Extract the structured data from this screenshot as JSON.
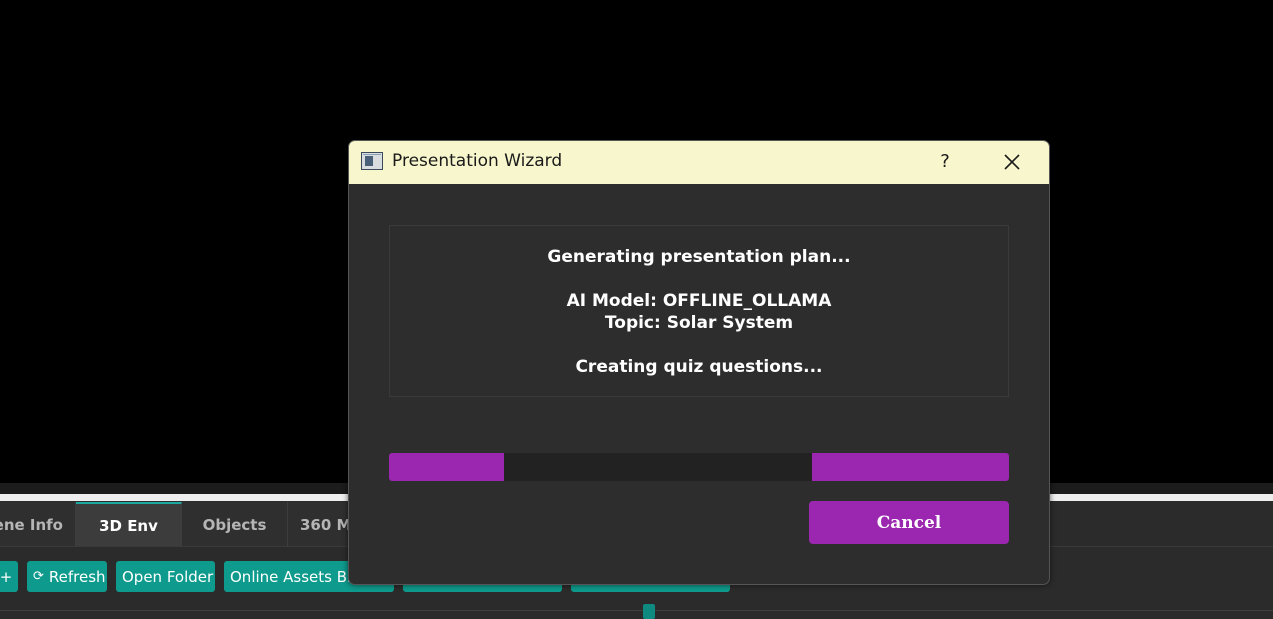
{
  "app": {
    "tabs": [
      {
        "label": "Scene Info",
        "active": false
      },
      {
        "label": "3D Env",
        "active": true
      },
      {
        "label": "Objects",
        "active": false
      },
      {
        "label": "360 M",
        "active": false
      }
    ],
    "toolbar": [
      {
        "label": "+",
        "icon": ""
      },
      {
        "label": "Refresh",
        "icon": "refresh-icon"
      },
      {
        "label": "Open Folder",
        "icon": ""
      },
      {
        "label": "Online Assets Br",
        "icon": ""
      },
      {
        "label": "",
        "icon": ""
      },
      {
        "label": "",
        "icon": ""
      }
    ],
    "colors": {
      "accent_teal": "#0e9a8c",
      "accent_purple": "#9b27b0",
      "titlebar": "#f8f6cc"
    }
  },
  "dialog": {
    "title": "Presentation Wizard",
    "help_label": "?",
    "status_heading": "Generating presentation plan...",
    "model_line": "AI Model: OFFLINE_OLLAMA",
    "topic_line": "Topic: Solar System",
    "step_line": "Creating quiz questions...",
    "progress": {
      "mode": "indeterminate"
    },
    "cancel_label": "Cancel"
  }
}
